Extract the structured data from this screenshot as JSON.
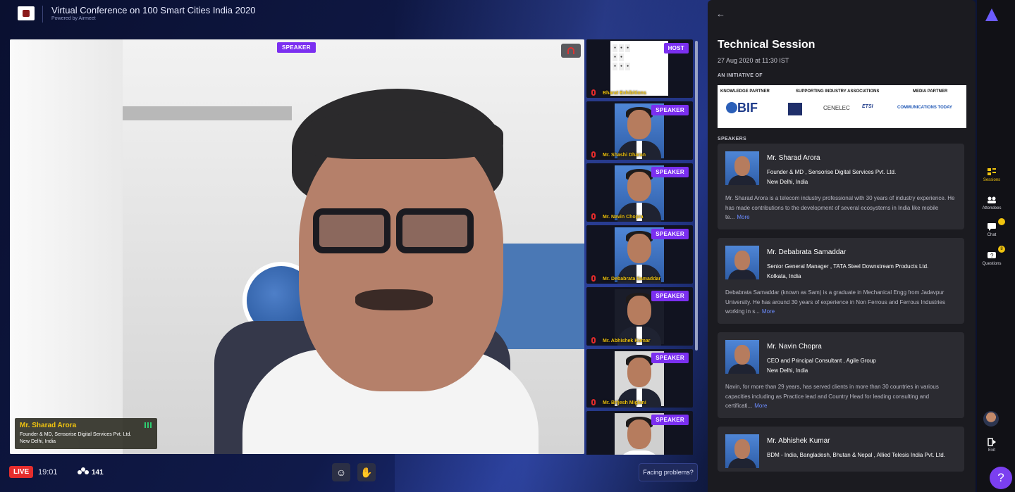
{
  "header": {
    "title": "Virtual Conference on 100 Smart Cities India 2020",
    "powered_by": "Powered by Airmeet"
  },
  "main_video": {
    "badge": "SPEAKER",
    "speaker_name": "Mr. Sharad Arora",
    "speaker_role": "Founder & MD, Sensorise Digital Services Pvt. Ltd.",
    "speaker_location": "New Delhi, India"
  },
  "tiles": [
    {
      "badge": "HOST",
      "name": "Bharat Exhibitions"
    },
    {
      "badge": "SPEAKER",
      "name": "Mr. Shashi Dharan"
    },
    {
      "badge": "SPEAKER",
      "name": "Mr. Navin Chopra"
    },
    {
      "badge": "SPEAKER",
      "name": "Mr. Debabrata Samaddar"
    },
    {
      "badge": "SPEAKER",
      "name": "Mr. Abhishek Kumar"
    },
    {
      "badge": "SPEAKER",
      "name": "Mr. Brijesh Miglani"
    },
    {
      "badge": "SPEAKER",
      "name": ""
    }
  ],
  "bottom_bar": {
    "live_label": "LIVE",
    "time": "19:01",
    "attendee_count": "141",
    "facing_problems": "Facing problems?"
  },
  "panel": {
    "title": "Technical Session",
    "date": "27 Aug 2020 at 11:30 IST",
    "initiative_label": "AN INITIATIVE OF",
    "partners": {
      "knowledge": "KNOWLEDGE PARTNER",
      "supporting": "SUPPORTING INDUSTRY ASSOCIATIONS",
      "media": "MEDIA PARTNER",
      "bif": "BIF",
      "cenelec": "CENELEC",
      "etsi": "ETSI",
      "comm_today": "COMMUNICATIONS TODAY"
    },
    "speakers_label": "SPEAKERS",
    "speakers": [
      {
        "name": "Mr. Sharad Arora",
        "role": "Founder & MD , Sensorise Digital Services Pvt. Ltd.",
        "location": "New Delhi, India",
        "bio": "Mr. Sharad Arora is a telecom industry professional with 30 years of industry experience. He has made contributions to the development of several ecosystems in India like mobile te...",
        "more": "More"
      },
      {
        "name": "Mr. Debabrata Samaddar",
        "role": "Senior General Manager , TATA Steel Downstream Products Ltd.",
        "location": "Kolkata, India",
        "bio": "Debabrata Samaddar (known as Sam) is a graduate in Mechanical Engg from Jadavpur University. He has around 30 years of experience in Non Ferrous and Ferrous Industries working in s...",
        "more": "More"
      },
      {
        "name": "Mr. Navin Chopra",
        "role": "CEO and Principal Consultant , Agile Group",
        "location": "New Delhi, India",
        "bio": "Navin, for more than 29 years, has served clients in more than 30 countries in various capacities including as Practice lead and Country Head for leading consulting and certificati...",
        "more": "More"
      },
      {
        "name": "Mr. Abhishek Kumar",
        "role": "BDM - India, Bangladesh, Bhutan & Nepal , Allied Telesis India Pvt. Ltd.",
        "location": "",
        "bio": "",
        "more": ""
      }
    ]
  },
  "rail": {
    "sessions": "Sessions",
    "attendees": "Attendees",
    "chat": "Chat",
    "questions": "Questions",
    "questions_count": "8",
    "exit": "Exit"
  },
  "help": "?"
}
